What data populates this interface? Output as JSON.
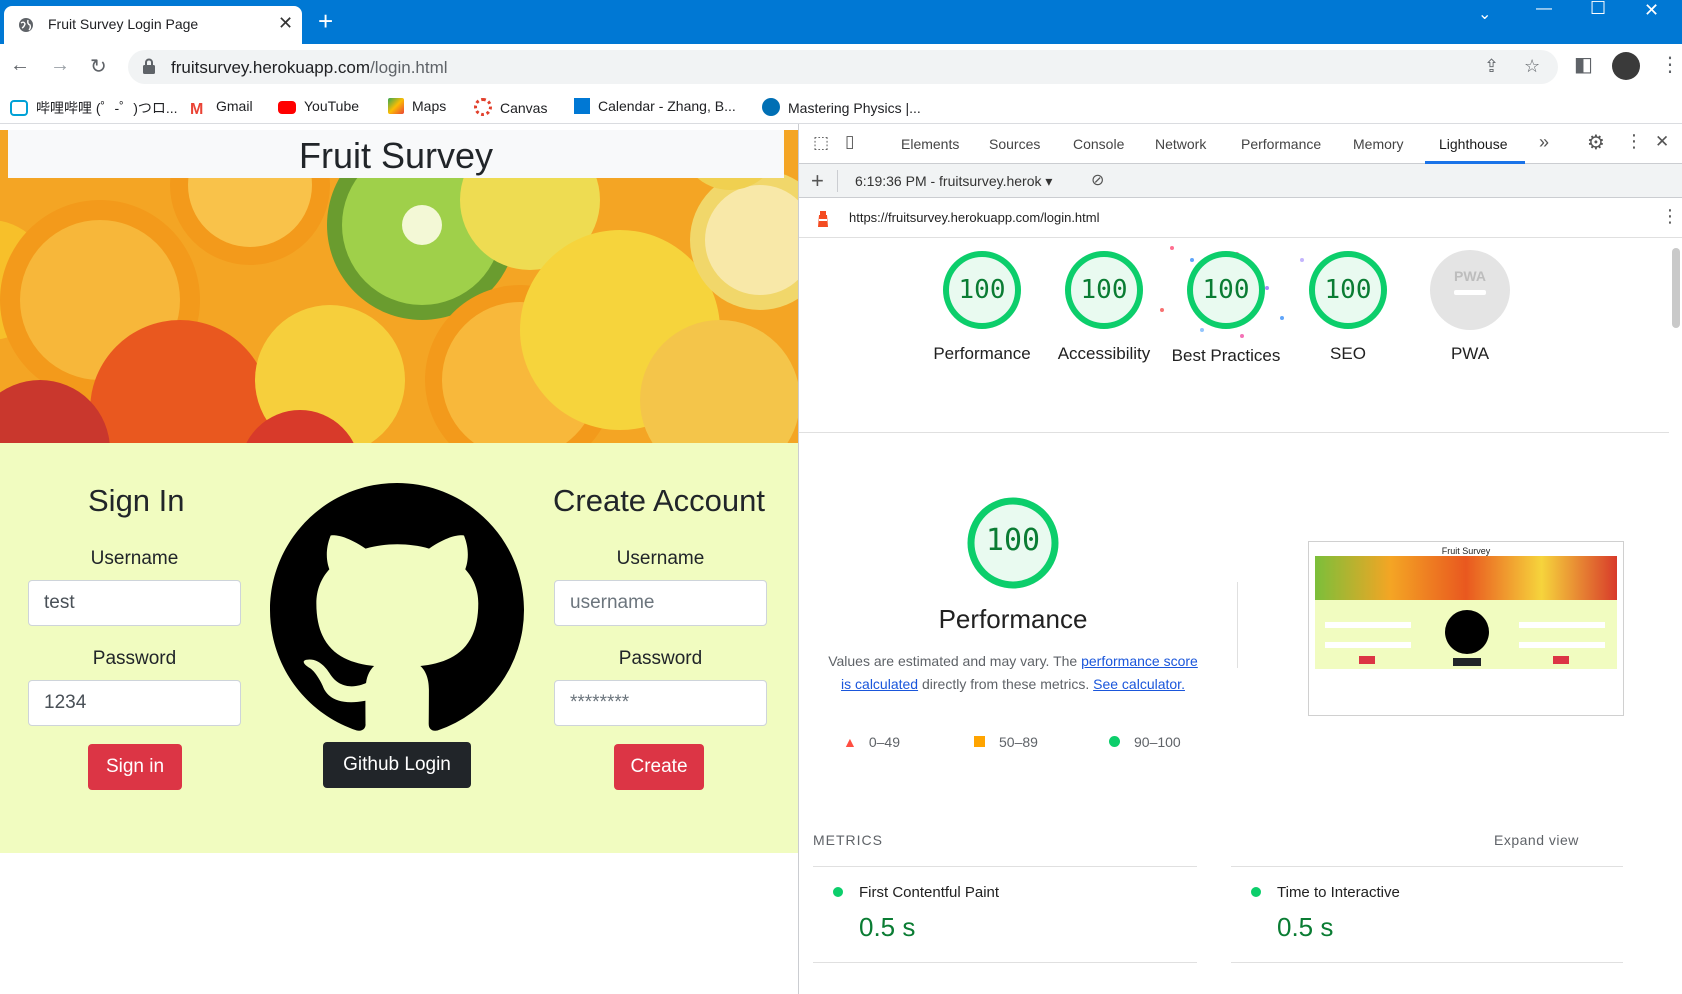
{
  "browser": {
    "tab_title": "Fruit Survey Login Page",
    "url_host": "fruitsurvey.herokuapp.com",
    "url_path": "/login.html",
    "bookmarks": [
      {
        "label": "哔哩哔哩 (゜-゜)つロ...",
        "icon": "bilibili-icon",
        "color": "#00a1d6"
      },
      {
        "label": "Gmail",
        "icon": "gmail-icon",
        "color": "#ea4335"
      },
      {
        "label": "YouTube",
        "icon": "youtube-icon",
        "color": "#ff0000"
      },
      {
        "label": "Maps",
        "icon": "maps-icon",
        "color": "#34a853"
      },
      {
        "label": "Canvas",
        "icon": "canvas-icon",
        "color": "#e13f2b"
      },
      {
        "label": "Calendar - Zhang, B...",
        "icon": "calendar-icon",
        "color": "#0078d4"
      },
      {
        "label": "Mastering Physics |...",
        "icon": "mastering-physics-icon",
        "color": "#006fb4"
      }
    ],
    "colors": {
      "tabstrip": "#0078d4"
    }
  },
  "site": {
    "title": "Fruit Survey",
    "sign_in": {
      "heading": "Sign In",
      "username_label": "Username",
      "username_value": "test",
      "password_label": "Password",
      "password_value": "1234",
      "button": "Sign in"
    },
    "github_button": "Github Login",
    "create": {
      "heading": "Create Account",
      "username_label": "Username",
      "username_placeholder": "username",
      "password_label": "Password",
      "password_placeholder": "********",
      "button": "Create"
    },
    "colors": {
      "form_bg": "#f1fcc0",
      "danger": "#dc3545",
      "dark": "#212529"
    }
  },
  "devtools": {
    "tabs": [
      "Elements",
      "Sources",
      "Console",
      "Network",
      "Performance",
      "Memory",
      "Lighthouse"
    ],
    "active_tab": "Lighthouse",
    "report_select": "6:19:36 PM - fruitsurvey.herok",
    "report_url": "https://fruitsurvey.herokuapp.com/login.html",
    "scores": [
      {
        "label": "Performance",
        "value": "100"
      },
      {
        "label": "Accessibility",
        "value": "100"
      },
      {
        "label": "Best Practices",
        "value": "100"
      },
      {
        "label": "SEO",
        "value": "100"
      },
      {
        "label": "PWA",
        "value": "PWA"
      }
    ],
    "performance": {
      "score": "100",
      "title": "Performance",
      "desc_1": "Values are estimated and may vary. The ",
      "link_1": "performance score is calculated",
      "desc_2": " directly from these metrics. ",
      "link_2": "See calculator.",
      "legend": [
        "0–49",
        "50–89",
        "90–100"
      ],
      "thumb_title": "Fruit Survey"
    },
    "metrics": {
      "heading": "METRICS",
      "expand": "Expand view",
      "items": [
        {
          "title": "First Contentful Paint",
          "value": "0.5 s"
        },
        {
          "title": "Time to Interactive",
          "value": "0.5 s"
        }
      ]
    },
    "colors": {
      "pass": "#0cce6b",
      "pass_text": "#0a7c33",
      "average": "#ffa400",
      "fail": "#ff4e42",
      "accent": "#1a73e8"
    }
  }
}
